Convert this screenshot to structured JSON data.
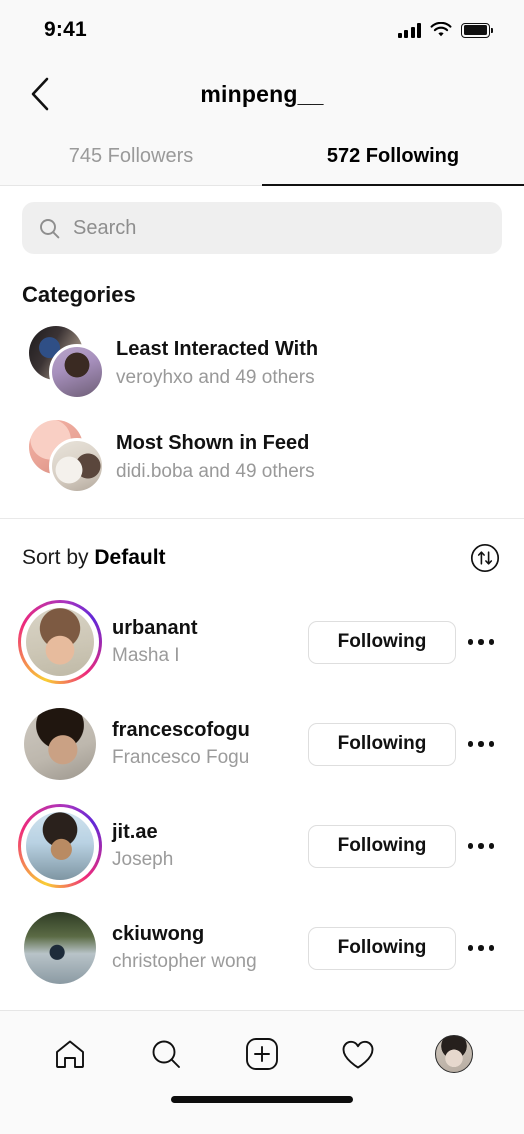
{
  "status_bar": {
    "time": "9:41",
    "signal_icon": "cellular-bars-icon",
    "wifi_icon": "wifi-icon",
    "battery_icon": "battery-full-icon"
  },
  "header": {
    "back_icon": "chevron-left-icon",
    "title": "minpeng__"
  },
  "tabs": [
    {
      "label": "745 Followers",
      "active": false
    },
    {
      "label": "572 Following",
      "active": true
    }
  ],
  "search": {
    "placeholder": "Search",
    "value": "",
    "icon": "search-icon"
  },
  "categories": {
    "title": "Categories",
    "items": [
      {
        "name": "Least Interacted With",
        "subtitle": "veroyhxo and 49 others"
      },
      {
        "name": "Most Shown in Feed",
        "subtitle": "didi.boba and 49 others"
      }
    ]
  },
  "sort": {
    "prefix": "Sort by",
    "value": "Default",
    "toggle_icon": "sort-arrows-circle-icon"
  },
  "users": [
    {
      "username": "urbanant",
      "fullname": "Masha I",
      "button": "Following",
      "has_story": true,
      "menu_icon": "more-options-icon"
    },
    {
      "username": "francescofogu",
      "fullname": "Francesco Fogu",
      "button": "Following",
      "has_story": false,
      "menu_icon": "more-options-icon"
    },
    {
      "username": "jit.ae",
      "fullname": "Joseph",
      "button": "Following",
      "has_story": true,
      "menu_icon": "more-options-icon"
    },
    {
      "username": "ckiuwong",
      "fullname": "christopher wong",
      "button": "Following",
      "has_story": false,
      "menu_icon": "more-options-icon"
    }
  ],
  "tabbar": [
    {
      "icon": "home-icon"
    },
    {
      "icon": "search-icon"
    },
    {
      "icon": "create-post-icon"
    },
    {
      "icon": "heart-icon"
    },
    {
      "icon": "profile-avatar-icon"
    }
  ],
  "colors": {
    "accent": "#000000",
    "muted_text": "#9b9b9b",
    "search_bg": "#efefef",
    "border": "#dedede",
    "story_gradient_start": "#f9ce34",
    "story_gradient_mid": "#ee2a7b",
    "story_gradient_end": "#6228d7"
  }
}
